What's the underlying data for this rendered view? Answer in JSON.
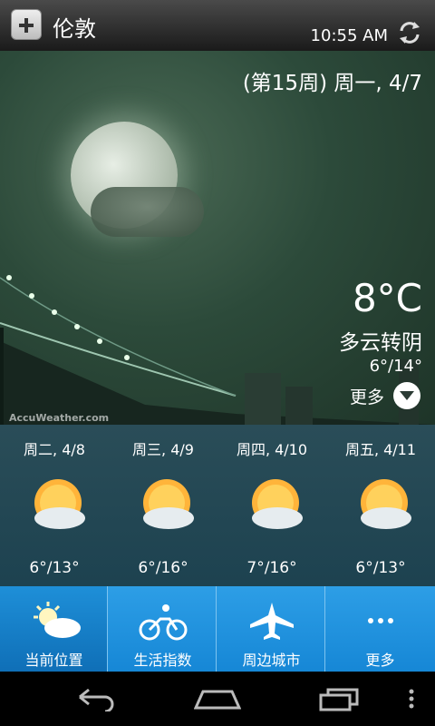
{
  "header": {
    "city": "伦敦",
    "time": "10:55 AM"
  },
  "current": {
    "date_line": "(第15周) 周一, 4/7",
    "temperature": "8°C",
    "condition": "多云转阴",
    "range": "6°/14°",
    "more_label": "更多"
  },
  "brand": "AccuWeather.com",
  "forecast": [
    {
      "date": "周二, 4/8",
      "range": "6°/13°"
    },
    {
      "date": "周三, 4/9",
      "range": "6°/16°"
    },
    {
      "date": "周四, 4/10",
      "range": "7°/16°"
    },
    {
      "date": "周五, 4/11",
      "range": "6°/13°"
    }
  ],
  "tabs": [
    {
      "label": "当前位置",
      "icon": "partly-sunny-icon"
    },
    {
      "label": "生活指数",
      "icon": "bicycle-icon"
    },
    {
      "label": "周边城市",
      "icon": "airplane-icon"
    },
    {
      "label": "更多",
      "icon": "ellipsis-icon"
    }
  ],
  "colors": {
    "tab_bar": "#2d9ee6",
    "tab_active": "#1e8fd8",
    "hero": "#2c4a3a",
    "forecast_bg": "#244a55"
  }
}
